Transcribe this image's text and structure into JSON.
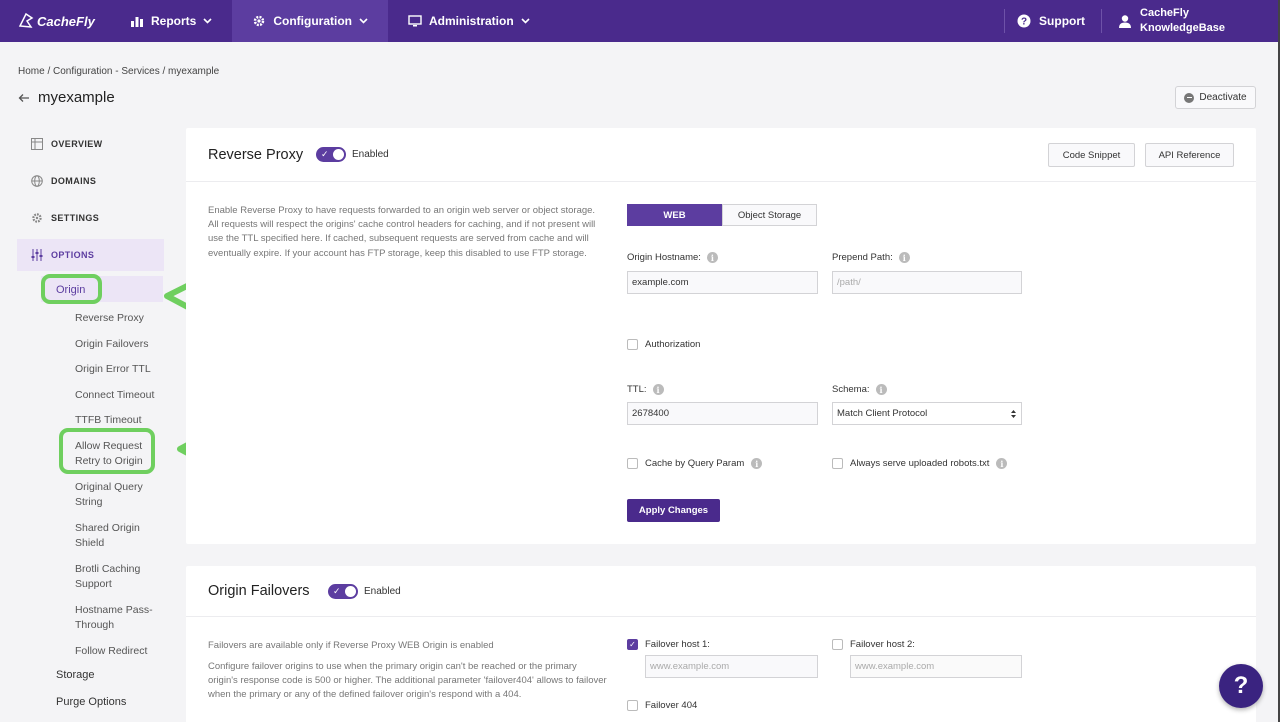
{
  "topnav": {
    "logo": "CacheFly",
    "items": [
      {
        "label": "Reports",
        "icon": "bar-chart-icon"
      },
      {
        "label": "Configuration",
        "icon": "gear-icon"
      },
      {
        "label": "Administration",
        "icon": "monitor-icon"
      }
    ],
    "support": "Support",
    "user_line1": "CacheFly",
    "user_line2": "KnowledgeBase"
  },
  "breadcrumb": "Home / Configuration - Services / myexample",
  "page_title": "myexample",
  "deactivate_label": "Deactivate",
  "sidebar": {
    "main": [
      {
        "label": "OVERVIEW",
        "icon": "grid-icon"
      },
      {
        "label": "DOMAINS",
        "icon": "globe-icon"
      },
      {
        "label": "SETTINGS",
        "icon": "gear-icon"
      },
      {
        "label": "OPTIONS",
        "icon": "sliders-icon"
      }
    ],
    "origin": "Origin",
    "sub_items": [
      "Reverse Proxy",
      "Origin Failovers",
      "Origin Error TTL",
      "Connect Timeout",
      "TTFB Timeout",
      "Allow Request Retry to Origin",
      "Original Query String",
      "Shared Origin Shield",
      "Brotli Caching Support",
      "Hostname Pass-Through",
      "Follow Redirect"
    ],
    "storage": "Storage",
    "purge": "Purge Options"
  },
  "reverse_proxy": {
    "title": "Reverse Proxy",
    "toggle_label": "Enabled",
    "code_snippet": "Code Snippet",
    "api_reference": "API Reference",
    "description": "Enable Reverse Proxy to have requests forwarded to an origin web server or object storage. All requests will respect the origins' cache control headers for caching, and if not present will use the TTL specified here. If cached, subsequent requests are served from cache and will eventually expire. If your account has FTP storage, keep this disabled to use FTP storage.",
    "tab_web": "WEB",
    "tab_object": "Object Storage",
    "origin_hostname_label": "Origin Hostname:",
    "origin_hostname_value": "example.com",
    "prepend_path_label": "Prepend Path:",
    "prepend_path_placeholder": "/path/",
    "authorization_label": "Authorization",
    "ttl_label": "TTL:",
    "ttl_value": "2678400",
    "schema_label": "Schema:",
    "schema_value": "Match Client Protocol",
    "cache_query_label": "Cache by Query Param",
    "robots_label": "Always serve uploaded robots.txt",
    "apply_label": "Apply Changes"
  },
  "origin_failovers": {
    "title": "Origin Failovers",
    "toggle_label": "Enabled",
    "desc1": "Failovers are available only if Reverse Proxy WEB Origin is enabled",
    "desc2": "Configure failover origins to use when the primary origin can't be reached or the primary origin's response code is 500 or higher. The additional parameter 'failover404' allows to failover when the primary or any of the defined failover origin's respond with a 404.",
    "host1_label": "Failover host 1:",
    "host1_placeholder": "www.example.com",
    "host2_label": "Failover host 2:",
    "host2_placeholder": "www.example.com",
    "failover404_label": "Failover 404"
  },
  "help_label": "?",
  "colors": {
    "nav": "#4a2a8c",
    "accent": "#5c3da0",
    "highlight": "#6fcf5f"
  }
}
